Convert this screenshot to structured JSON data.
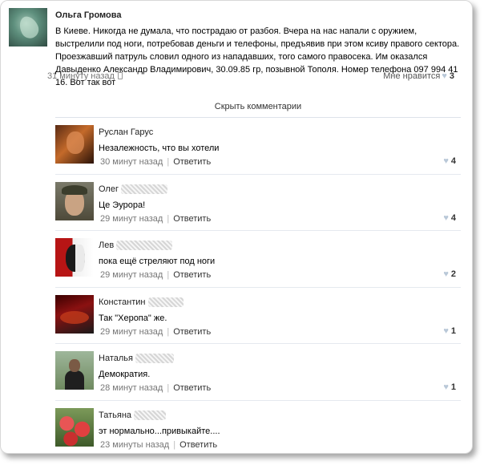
{
  "post": {
    "author": "Ольга Громова",
    "text": "В Киеве. Никогда не думала, что пострадаю от разбоя. Вчера на нас напали с оружием, выстрелили под ноги, потребовав деньги и телефоны, предъявив при этом ксиву правого сектора. Проезжавший патруль словил одного из нападавших, того самого правосека. Им оказался Давыденко Александр Владимирович, 30.09.85 гр, позывной Тополя. Номер телефона 097 994 41 16. Вот так вот",
    "time": "31 минуту назад",
    "like_label": "Мне нравится",
    "like_count": "3"
  },
  "hide_comments": "Скрыть комментарии",
  "comments": [
    {
      "name": "Руслан Гарус",
      "text": "Незалежность, что вы хотели",
      "time": "30 минут назад",
      "reply": "Ответить",
      "likes": "4"
    },
    {
      "name": "Олег",
      "text": "Це Эурора!",
      "time": "29 минут назад",
      "reply": "Ответить",
      "likes": "4"
    },
    {
      "name": "Лев",
      "text": "пока ещё стреляют под ноги",
      "time": "29 минут назад",
      "reply": "Ответить",
      "likes": "2"
    },
    {
      "name": "Константин",
      "text": "Так \"Херопа\" же.",
      "time": "29 минут назад",
      "reply": "Ответить",
      "likes": "1"
    },
    {
      "name": "Наталья",
      "text": "Демократия.",
      "time": "28 минут назад",
      "reply": "Ответить",
      "likes": "1"
    },
    {
      "name": "Татьяна",
      "text": "эт нормально...привыкайте....",
      "time": "23 минуты назад",
      "reply": "Ответить",
      "likes": ""
    }
  ],
  "icons": {
    "heart": "heart-icon",
    "mobile": "mobile-icon"
  },
  "colors": {
    "heart": "#b9c8d8",
    "separator": "#e5e9ef",
    "meta_gray": "#777777"
  }
}
